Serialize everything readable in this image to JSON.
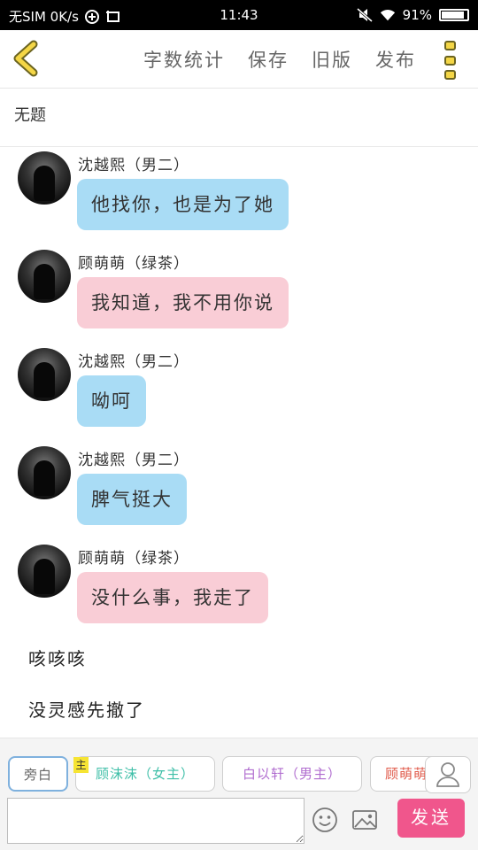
{
  "status_bar": {
    "carrier": "无SIM 0K/s",
    "time": "11:43",
    "battery": "91%",
    "battery_level": 0.91
  },
  "toolbar": {
    "actions": [
      "字数统计",
      "保存",
      "旧版",
      "发布"
    ]
  },
  "document": {
    "title": "无题"
  },
  "messages": [
    {
      "speaker": "沈越熙（男二）",
      "text": "他找你，也是为了她",
      "color": "blue"
    },
    {
      "speaker": "顾萌萌（绿茶）",
      "text": "我知道，我不用你说",
      "color": "pink"
    },
    {
      "speaker": "沈越熙（男二）",
      "text": "呦呵",
      "color": "blue"
    },
    {
      "speaker": "沈越熙（男二）",
      "text": "脾气挺大",
      "color": "blue"
    },
    {
      "speaker": "顾萌萌（绿茶）",
      "text": "没什么事，我走了",
      "color": "pink"
    }
  ],
  "narration": [
    "咳咳咳",
    "没灵感先撤了"
  ],
  "character_bar": {
    "narration_label": "旁白",
    "main_tag": "主",
    "characters": [
      "顾沫沫（女主）",
      "白以轩（男主）",
      "顾萌萌"
    ]
  },
  "input": {
    "value": "",
    "placeholder": "",
    "send_label": "发送"
  },
  "colors": {
    "bubble_blue": "#a9dcf5",
    "bubble_pink": "#f9cdd6",
    "send": "#f0568c",
    "accent_yellow": "#f4d646"
  }
}
